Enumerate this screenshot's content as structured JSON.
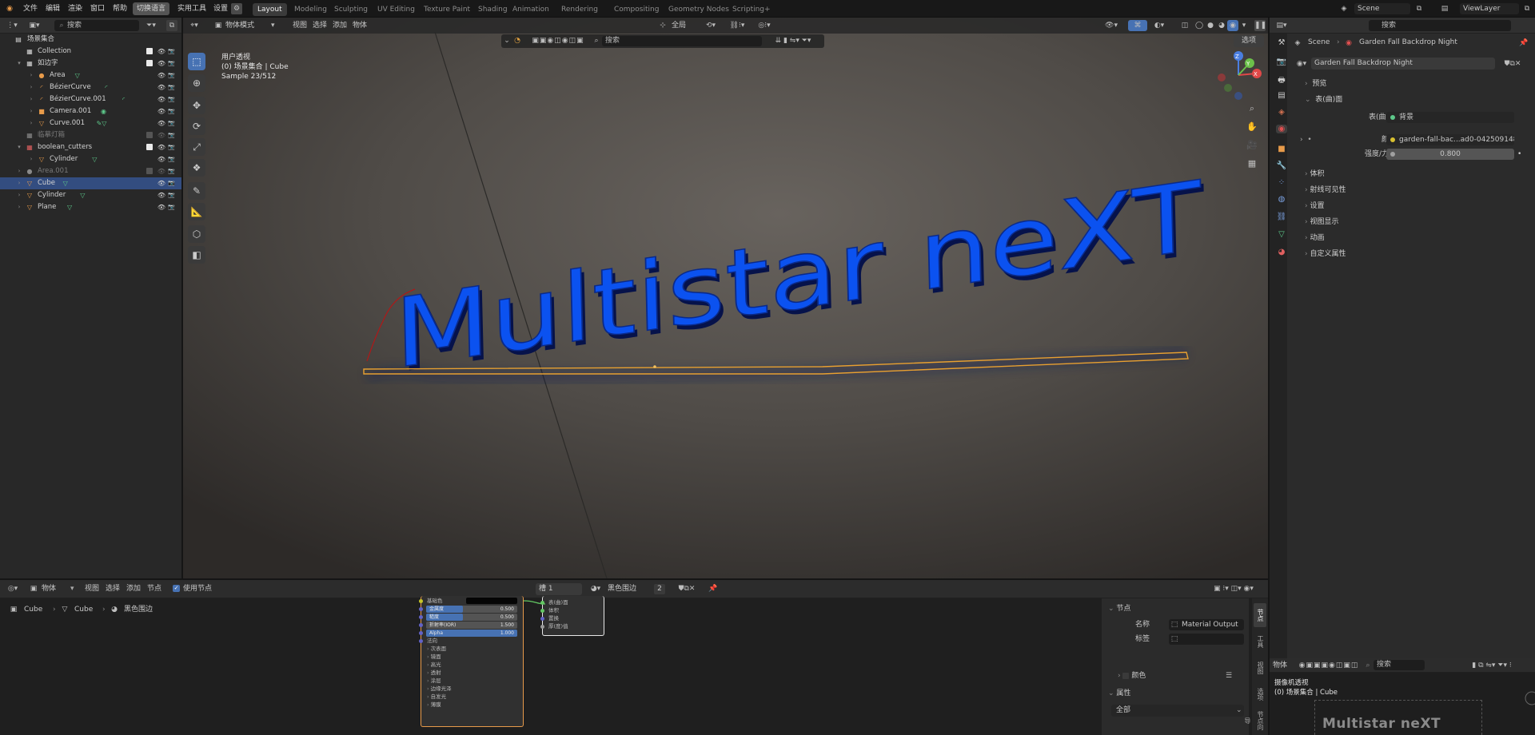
{
  "top_menu": {
    "app_icon": "blender-icon",
    "items": [
      "文件",
      "编辑",
      "渲染",
      "窗口",
      "帮助"
    ],
    "lang_toggle": "切换语言",
    "extra": [
      "实用工具",
      "设置"
    ]
  },
  "workspaces": [
    "Layout",
    "Modeling",
    "Sculpting",
    "UV Editing",
    "Texture Paint",
    "Shading",
    "Animation",
    "Rendering",
    "Compositing",
    "Geometry Nodes",
    "Scripting",
    "+"
  ],
  "scene": {
    "name": "Scene",
    "view_layer": "ViewLayer"
  },
  "outliner": {
    "search_placeholder": "搜索",
    "root": "场景集合",
    "rows": [
      {
        "label": "Collection",
        "indent": 1,
        "icon": "collection-icon",
        "sym": "▦",
        "color": "#d8d8d8",
        "check": true,
        "tri": ""
      },
      {
        "label": "如边字",
        "indent": 1,
        "icon": "collection-icon",
        "sym": "▦",
        "color": "#d8d8d8",
        "check": true,
        "tri": "▾"
      },
      {
        "label": "Area",
        "indent": 2,
        "icon": "light-icon",
        "sym": "●",
        "color": "#e89b4a",
        "tag": "▽",
        "tri": "›"
      },
      {
        "label": "BézierCurve",
        "indent": 2,
        "icon": "curve-icon",
        "sym": "◜",
        "color": "#e89b4a",
        "tag": "◜",
        "tri": "›"
      },
      {
        "label": "BézierCurve.001",
        "indent": 2,
        "icon": "curve-icon",
        "sym": "◜",
        "color": "#e89b4a",
        "tag": "◜",
        "tri": "›"
      },
      {
        "label": "Camera.001",
        "indent": 2,
        "icon": "camera-icon",
        "sym": "■",
        "color": "#e89b4a",
        "tag": "◉",
        "tri": "›"
      },
      {
        "label": "Curve.001",
        "indent": 2,
        "icon": "mesh-icon",
        "sym": "▽",
        "color": "#e89b4a",
        "tag": "✎▽",
        "tri": "›"
      },
      {
        "label": "临摹灯箱",
        "indent": 1,
        "icon": "collection-icon",
        "sym": "▦",
        "color": "#8a8a8a",
        "dim": true,
        "tri": ""
      },
      {
        "label": "boolean_cutters",
        "indent": 1,
        "icon": "collection-icon",
        "sym": "▦",
        "color": "#e06060",
        "check": true,
        "tri": "▾"
      },
      {
        "label": "Cylinder",
        "indent": 2,
        "icon": "mesh-icon",
        "sym": "▽",
        "color": "#e89b4a",
        "tag": "▽",
        "tri": "›"
      },
      {
        "label": "Area.001",
        "indent": 1,
        "icon": "light-icon",
        "sym": "●",
        "color": "#8a8a8a",
        "dim": true,
        "tri": "›"
      },
      {
        "label": "Cube",
        "indent": 1,
        "icon": "mesh-icon",
        "sym": "▽",
        "color": "#e89b4a",
        "tag": "▽",
        "tri": "›",
        "sel": true
      },
      {
        "label": "Cylinder",
        "indent": 1,
        "icon": "mesh-icon",
        "sym": "▽",
        "color": "#e89b4a",
        "tag": "▽",
        "tri": "›"
      },
      {
        "label": "Plane",
        "indent": 1,
        "icon": "mesh-icon",
        "sym": "▽",
        "color": "#e89b4a",
        "tag": "▽",
        "tri": "›"
      }
    ]
  },
  "viewport": {
    "mode": "物体模式",
    "menus": [
      "视图",
      "选择",
      "添加",
      "物体"
    ],
    "transform": "全局",
    "options": "选项",
    "search_placeholder": "搜索",
    "overlay_lines": [
      "用户透视",
      "(0) 场景集合 | Cube",
      "Sample 23/512"
    ],
    "sign_text": "Multistar neXT",
    "gizmo": {
      "x": "X",
      "y": "Y",
      "z": "Z"
    }
  },
  "properties": {
    "breadcrumb": [
      "Scene",
      "Garden Fall Backdrop Night"
    ],
    "world_name": "Garden Fall Backdrop Night",
    "panels_top": [
      "预览",
      "表(曲)面"
    ],
    "surface_label": "表(曲)面",
    "surface_value": "背景",
    "color_label": "颜色",
    "color_value": "garden-fall-bac...ad0-042509148",
    "strength_label": "强度/力度",
    "strength_value": "0.800",
    "panels": [
      "体积",
      "射线可见性",
      "设置",
      "视图显示",
      "动画",
      "自定义属性"
    ]
  },
  "node_editor": {
    "type": "物体",
    "menus": [
      "视图",
      "选择",
      "添加",
      "节点"
    ],
    "use_nodes": "使用节点",
    "slot": "槽 1",
    "material": "黑色围边",
    "users": "2",
    "breadcrumb": [
      "Cube",
      "Cube",
      "黑色围边"
    ],
    "bsdf_rows": [
      {
        "label": "基础色",
        "kind": "color"
      },
      {
        "label": "金属度",
        "value": "0.500",
        "fill": 0.4
      },
      {
        "label": "糙度",
        "value": "0.500",
        "fill": 0.4
      },
      {
        "label": "折射率(IOR)",
        "value": "1.500",
        "fill": 0.0
      },
      {
        "label": "Alpha",
        "value": "1.000",
        "fill": 1.0
      }
    ],
    "bsdf_sections": [
      "法向",
      "次表面",
      "镜面",
      "高光",
      "透射",
      "涂层",
      "边缘光泽",
      "自发光",
      "薄膜"
    ],
    "output_rows": [
      "表(曲)面",
      "体积",
      "置换",
      "厚(度)值"
    ]
  },
  "node_sidebar": {
    "section": "节点",
    "name_label": "名称",
    "name_value": "Material Output",
    "label_label": "标签",
    "label_value": "",
    "color_section": "颜色",
    "props_section": "属性",
    "props_value": "全部",
    "tabs": [
      "节点",
      "工具",
      "视图",
      "选项",
      "节点向导"
    ]
  },
  "camera_preview": {
    "title": "摄像机透视",
    "sub": "(0) 场景集合 | Cube",
    "sign": "Multistar neXT",
    "type": "物体",
    "search_placeholder": "搜索"
  }
}
